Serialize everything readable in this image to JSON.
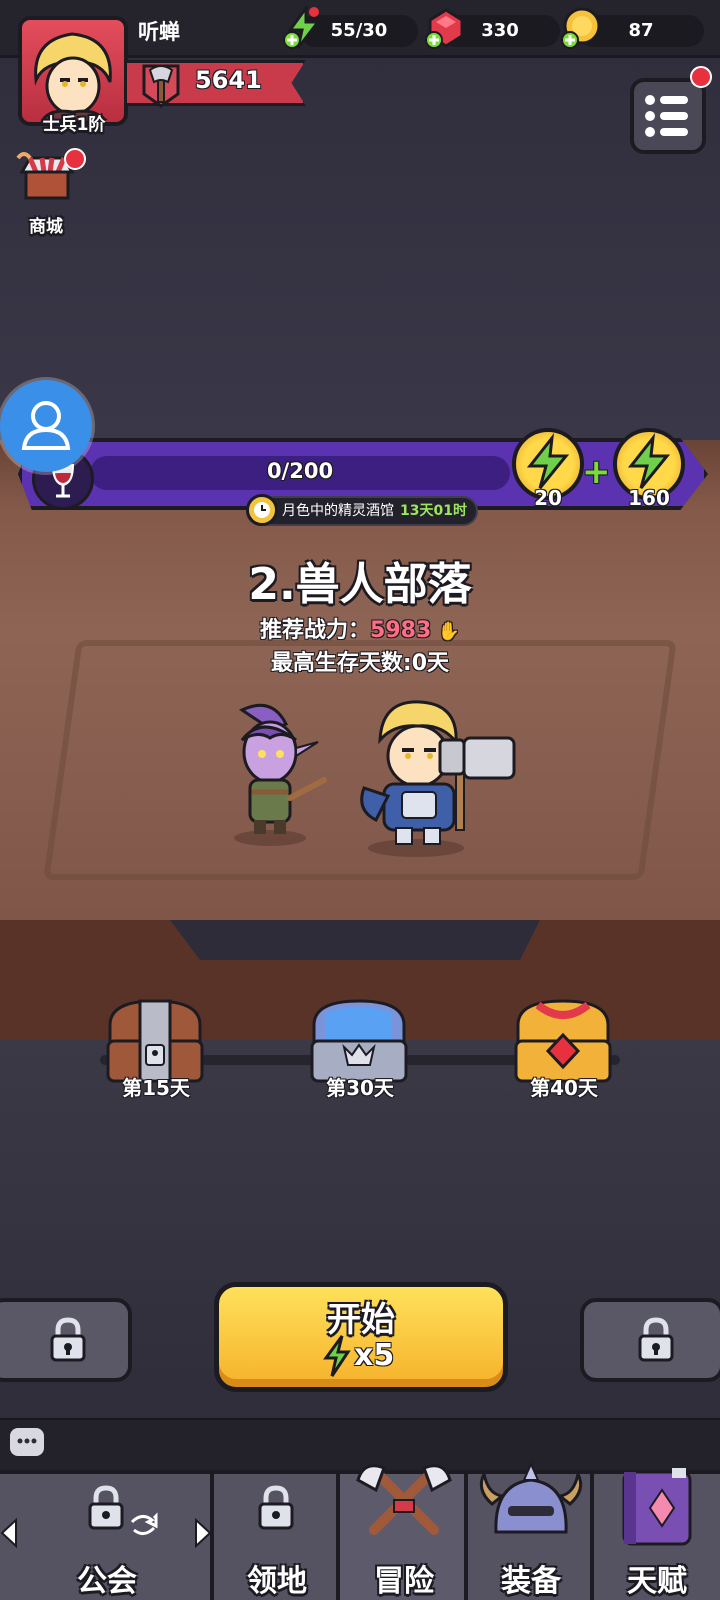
{
  "player": {
    "name": "听蝉",
    "rank": "士兵1阶",
    "power": "5641"
  },
  "resources": {
    "energy": "55/30",
    "gems": "330",
    "gold": "87"
  },
  "shop": {
    "label": "商城"
  },
  "event": {
    "progress_text": "0/200",
    "progress_fraction": 0,
    "reward_1": "20",
    "reward_2": "160",
    "name": "月色中的精灵酒馆",
    "timer": "13天01时"
  },
  "stage": {
    "title": "2.兽人部落",
    "rec_power_label": "推荐战力：",
    "rec_power_value": "5983",
    "max_days_label": "最高生存天数:",
    "max_days_value": "0",
    "max_days_unit": "天"
  },
  "chests": [
    {
      "label": "第15天",
      "color": "#a0583a"
    },
    {
      "label": "第30天",
      "color": "#7b93d8"
    },
    {
      "label": "第40天",
      "color": "#f2b23a"
    }
  ],
  "start_button": {
    "label": "开始",
    "cost": "x5"
  },
  "nav": [
    {
      "label": "公会",
      "locked": true
    },
    {
      "label": "领地",
      "locked": true
    },
    {
      "label": "冒险",
      "locked": false
    },
    {
      "label": "装备",
      "locked": false
    },
    {
      "label": "天赋",
      "locked": false
    }
  ],
  "colors": {
    "accent_purple": "#5b32b0",
    "gold": "#f6b12a",
    "red": "#c93b4b"
  },
  "icons": [
    "energy-icon",
    "gem-icon",
    "gold-icon",
    "menu-icon",
    "shop-icon",
    "person-icon",
    "lock-icon",
    "chat-icon"
  ]
}
